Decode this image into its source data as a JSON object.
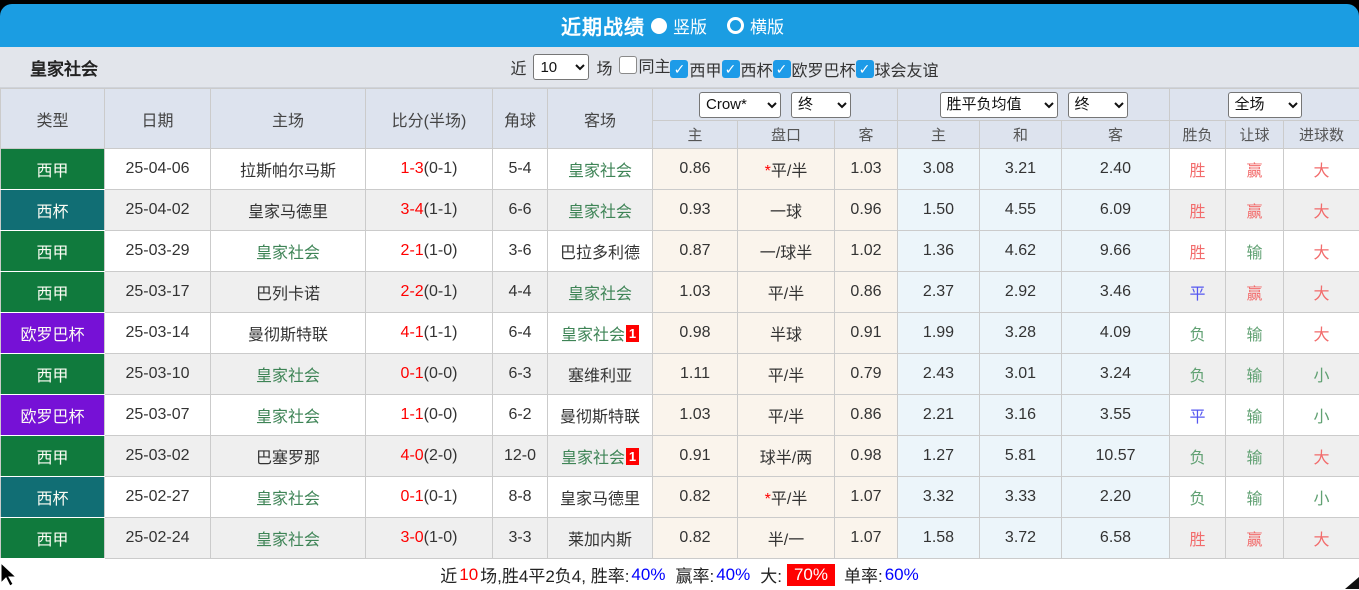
{
  "header": {
    "title": "近期战绩",
    "layout_options": [
      {
        "label": "竖版",
        "radio": "solid"
      },
      {
        "label": "横版",
        "radio": "ring"
      }
    ]
  },
  "filter_bar": {
    "team": "皇家社会",
    "recent_label": "近",
    "recent_value": "10",
    "games_label": "场",
    "checkboxes": [
      {
        "label": "同主",
        "checked": false
      },
      {
        "label": "西甲",
        "checked": true
      },
      {
        "label": "西杯",
        "checked": true
      },
      {
        "label": "欧罗巴杯",
        "checked": true
      },
      {
        "label": "球会友谊",
        "checked": true
      }
    ]
  },
  "table": {
    "main_headers": [
      "类型",
      "日期",
      "主场",
      "比分(半场)",
      "角球",
      "客场"
    ],
    "selects": {
      "handicap_company": "Crow*",
      "handicap_time": "终",
      "avg_label": "胜平负均值",
      "avg_time": "终",
      "result_scope": "全场"
    },
    "sub_headers": [
      "主",
      "盘口",
      "客",
      "主",
      "和",
      "客",
      "胜负",
      "让球",
      "进球数"
    ],
    "rows": [
      {
        "type": "西甲",
        "type_key": "liga",
        "date": "25-04-06",
        "home": "拉斯帕尔马斯",
        "home_self": false,
        "score": "1-3",
        "half": "(0-1)",
        "corners": "5-4",
        "away": "皇家社会",
        "away_self": true,
        "away_badge": "",
        "odds_home": "0.86",
        "handicap": "*平/半",
        "odds_away": "1.03",
        "avg_home": "3.08",
        "avg_draw": "3.21",
        "avg_away": "2.40",
        "result": "胜",
        "let_result": "赢",
        "goal_result": "大"
      },
      {
        "type": "西杯",
        "type_key": "copa",
        "date": "25-04-02",
        "home": "皇家马德里",
        "home_self": false,
        "score": "3-4",
        "half": "(1-1)",
        "corners": "6-6",
        "away": "皇家社会",
        "away_self": true,
        "away_badge": "",
        "odds_home": "0.93",
        "handicap": "一球",
        "odds_away": "0.96",
        "avg_home": "1.50",
        "avg_draw": "4.55",
        "avg_away": "6.09",
        "result": "胜",
        "let_result": "赢",
        "goal_result": "大"
      },
      {
        "type": "西甲",
        "type_key": "liga",
        "date": "25-03-29",
        "home": "皇家社会",
        "home_self": true,
        "score": "2-1",
        "half": "(1-0)",
        "corners": "3-6",
        "away": "巴拉多利德",
        "away_self": false,
        "away_badge": "",
        "odds_home": "0.87",
        "handicap": "一/球半",
        "odds_away": "1.02",
        "avg_home": "1.36",
        "avg_draw": "4.62",
        "avg_away": "9.66",
        "result": "胜",
        "let_result": "输",
        "goal_result": "大"
      },
      {
        "type": "西甲",
        "type_key": "liga",
        "date": "25-03-17",
        "home": "巴列卡诺",
        "home_self": false,
        "score": "2-2",
        "half": "(0-1)",
        "corners": "4-4",
        "away": "皇家社会",
        "away_self": true,
        "away_badge": "",
        "odds_home": "1.03",
        "handicap": "平/半",
        "odds_away": "0.86",
        "avg_home": "2.37",
        "avg_draw": "2.92",
        "avg_away": "3.46",
        "result": "平",
        "let_result": "赢",
        "goal_result": "大"
      },
      {
        "type": "欧罗巴杯",
        "type_key": "europa",
        "date": "25-03-14",
        "home": "曼彻斯特联",
        "home_self": false,
        "score": "4-1",
        "half": "(1-1)",
        "corners": "6-4",
        "away": "皇家社会",
        "away_self": true,
        "away_badge": "1",
        "odds_home": "0.98",
        "handicap": "半球",
        "odds_away": "0.91",
        "avg_home": "1.99",
        "avg_draw": "3.28",
        "avg_away": "4.09",
        "result": "负",
        "let_result": "输",
        "goal_result": "大"
      },
      {
        "type": "西甲",
        "type_key": "liga",
        "date": "25-03-10",
        "home": "皇家社会",
        "home_self": true,
        "score": "0-1",
        "half": "(0-0)",
        "corners": "6-3",
        "away": "塞维利亚",
        "away_self": false,
        "away_badge": "",
        "odds_home": "1.11",
        "handicap": "平/半",
        "odds_away": "0.79",
        "avg_home": "2.43",
        "avg_draw": "3.01",
        "avg_away": "3.24",
        "result": "负",
        "let_result": "输",
        "goal_result": "小"
      },
      {
        "type": "欧罗巴杯",
        "type_key": "europa",
        "date": "25-03-07",
        "home": "皇家社会",
        "home_self": true,
        "score": "1-1",
        "half": "(0-0)",
        "corners": "6-2",
        "away": "曼彻斯特联",
        "away_self": false,
        "away_badge": "",
        "odds_home": "1.03",
        "handicap": "平/半",
        "odds_away": "0.86",
        "avg_home": "2.21",
        "avg_draw": "3.16",
        "avg_away": "3.55",
        "result": "平",
        "let_result": "输",
        "goal_result": "小"
      },
      {
        "type": "西甲",
        "type_key": "liga",
        "date": "25-03-02",
        "home": "巴塞罗那",
        "home_self": false,
        "score": "4-0",
        "half": "(2-0)",
        "corners": "12-0",
        "away": "皇家社会",
        "away_self": true,
        "away_badge": "1",
        "odds_home": "0.91",
        "handicap": "球半/两",
        "odds_away": "0.98",
        "avg_home": "1.27",
        "avg_draw": "5.81",
        "avg_away": "10.57",
        "result": "负",
        "let_result": "输",
        "goal_result": "大"
      },
      {
        "type": "西杯",
        "type_key": "copa",
        "date": "25-02-27",
        "home": "皇家社会",
        "home_self": true,
        "score": "0-1",
        "half": "(0-1)",
        "corners": "8-8",
        "away": "皇家马德里",
        "away_self": false,
        "away_badge": "",
        "odds_home": "0.82",
        "handicap": "*平/半",
        "odds_away": "1.07",
        "avg_home": "3.32",
        "avg_draw": "3.33",
        "avg_away": "2.20",
        "result": "负",
        "let_result": "输",
        "goal_result": "小"
      },
      {
        "type": "西甲",
        "type_key": "liga",
        "date": "25-02-24",
        "home": "皇家社会",
        "home_self": true,
        "score": "3-0",
        "half": "(1-0)",
        "corners": "3-3",
        "away": "莱加内斯",
        "away_self": false,
        "away_badge": "",
        "odds_home": "0.82",
        "handicap": "半/一",
        "odds_away": "1.07",
        "avg_home": "1.58",
        "avg_draw": "3.72",
        "avg_away": "6.58",
        "result": "胜",
        "let_result": "赢",
        "goal_result": "大"
      }
    ]
  },
  "footer": {
    "t1": "近",
    "n": "10",
    "t2": "场,胜4平2负4, 胜率:",
    "p1": "40%",
    "t3": "赢率:",
    "p2": "40%",
    "t4": "大:",
    "p3": "70%",
    "t5": "单率:",
    "p4": "60%"
  },
  "colors": {
    "accent_blue": "#1b9de2",
    "liga": "#107a3d",
    "copa": "#116e74",
    "europa": "#7611d6",
    "self_green": "#3e8456",
    "score_red": "#ff0000",
    "win_red": "#f26c6c",
    "draw_blue": "#5557f0",
    "lose_green": "#61a173",
    "pct_blue": "#0000ff",
    "over_badge_bg": "#ff0000"
  }
}
